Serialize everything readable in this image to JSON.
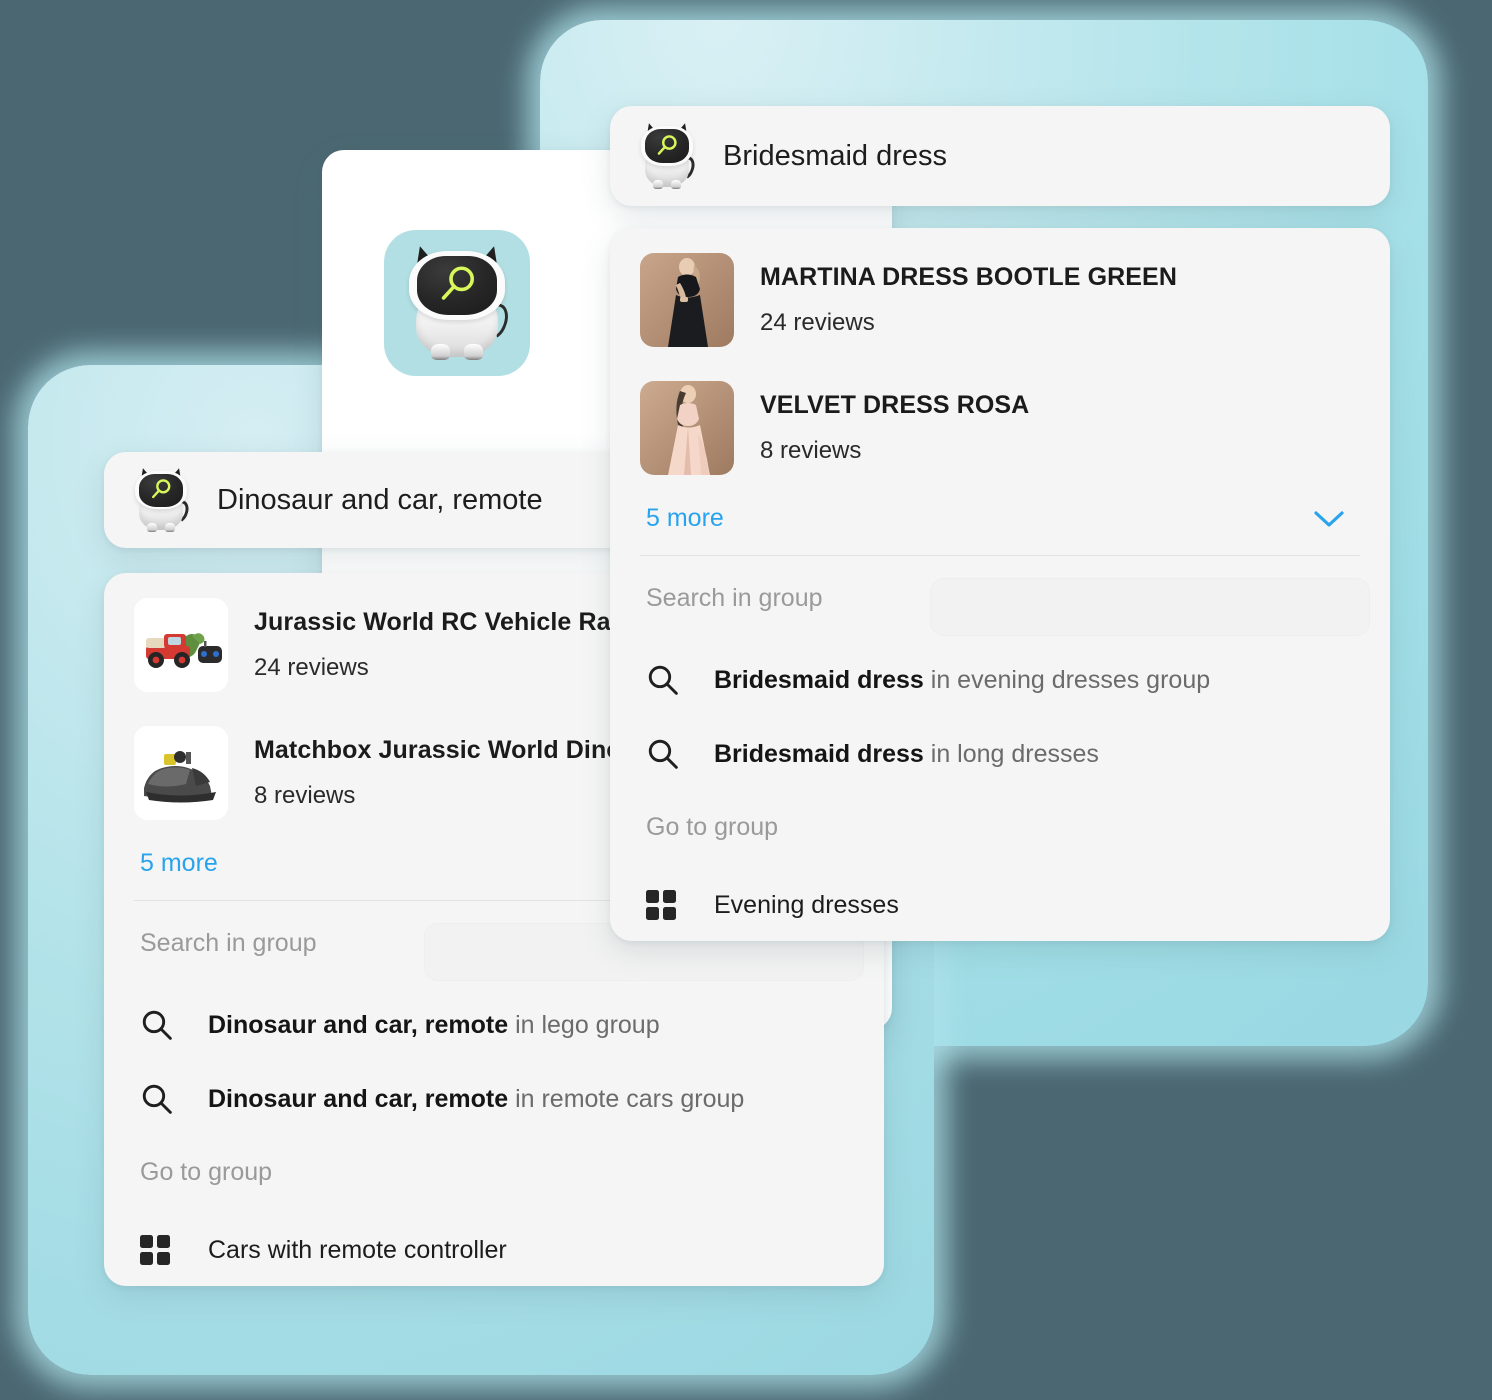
{
  "colors": {
    "page_background": "#4b6872",
    "backdrop_teal": "#a9dfe7",
    "card_background": "#f5f5f5",
    "accent_link": "#29a3ee",
    "mascot_accent": "#d7f75a",
    "app_tile": "#b2dfe3"
  },
  "app_card": {
    "icon_name": "mascot-search-icon"
  },
  "dress_card": {
    "query": "Bridesmaid dress",
    "search_icon_name": "mascot-search-icon",
    "results": [
      {
        "title": "MARTINA DRESS BOOTLE GREEN",
        "reviews": "24 reviews",
        "thumb_name": "black-evening-dress-thumbnail"
      },
      {
        "title": "VELVET DRESS ROSA",
        "reviews": "8 reviews",
        "thumb_name": "rose-velvet-dress-thumbnail"
      }
    ],
    "more_label": "5 more",
    "search_in_group_label": "Search in group",
    "suggestions": [
      {
        "query": "Bridesmaid dress",
        "scope": "in evening dresses group"
      },
      {
        "query": "Bridesmaid dress",
        "scope": "in long dresses"
      }
    ],
    "go_to_group_label": "Go to group",
    "groups": [
      {
        "name": "Evening dresses"
      }
    ]
  },
  "toy_card": {
    "query": "Dinosaur and car, remote",
    "search_icon_name": "mascot-search-icon",
    "results": [
      {
        "title": "Jurassic World RC Vehicle Raptor",
        "reviews": "24 reviews",
        "thumb_name": "rc-jeep-raptor-thumbnail"
      },
      {
        "title": "Matchbox Jurassic World Dino Transporter",
        "reviews": "8 reviews",
        "thumb_name": "dino-transporter-thumbnail"
      }
    ],
    "more_label": "5 more",
    "search_in_group_label": "Search in group",
    "suggestions": [
      {
        "query": "Dinosaur and car, remote",
        "scope": "in lego group"
      },
      {
        "query": "Dinosaur and car, remote",
        "scope": "in remote cars group"
      }
    ],
    "go_to_group_label": "Go to group",
    "groups": [
      {
        "name": "Cars with remote controller"
      }
    ]
  }
}
